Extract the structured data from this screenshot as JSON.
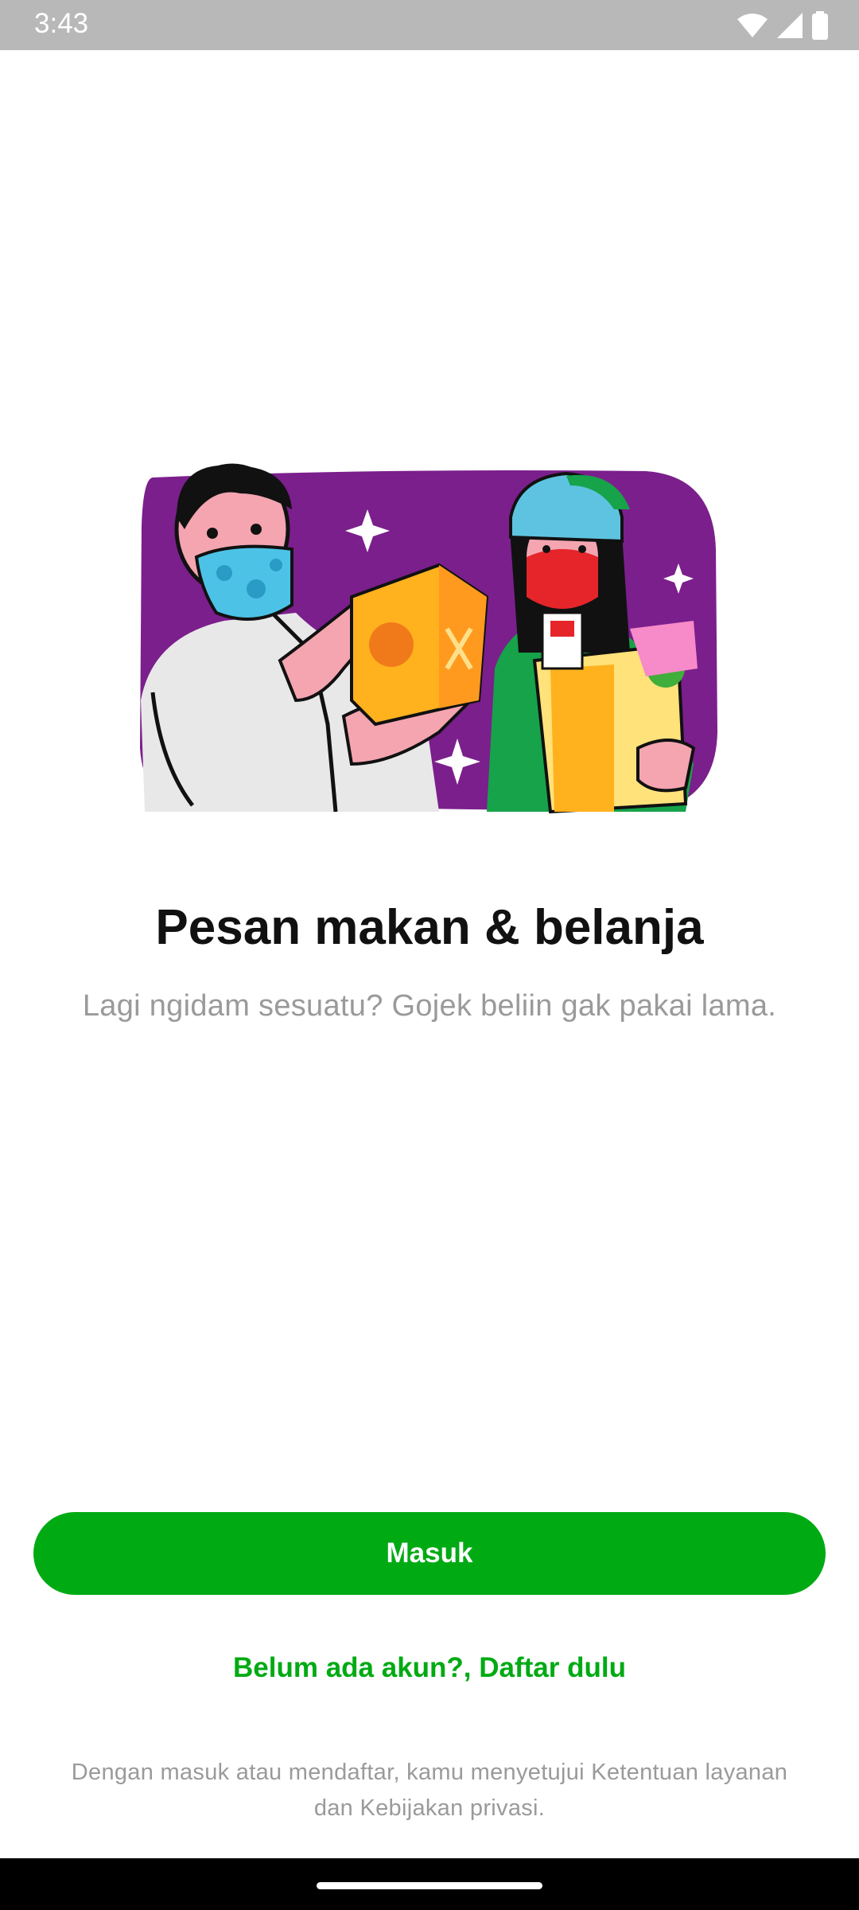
{
  "status_bar": {
    "time": "3:43",
    "icons": [
      "wifi-icon",
      "signal-icon",
      "battery-icon"
    ]
  },
  "onboarding": {
    "illustration": "food-and-grocery-delivery-illustration",
    "title": "Pesan makan & belanja",
    "subtitle": "Lagi ngidam sesuatu? Gojek beliin gak pakai lama."
  },
  "actions": {
    "login_label": "Masuk",
    "register_label": "Belum ada akun?, Daftar dulu"
  },
  "footer": {
    "terms_line1": "Dengan masuk atau mendaftar, kamu menyetujui Ketentuan layanan",
    "terms_line2": "dan Kebijakan privasi."
  },
  "colors": {
    "brand_green": "#00aa13",
    "status_bar": "#b8b8b8",
    "muted_text": "#9a9a9a",
    "illustration_purple": "#7b1f8c"
  }
}
